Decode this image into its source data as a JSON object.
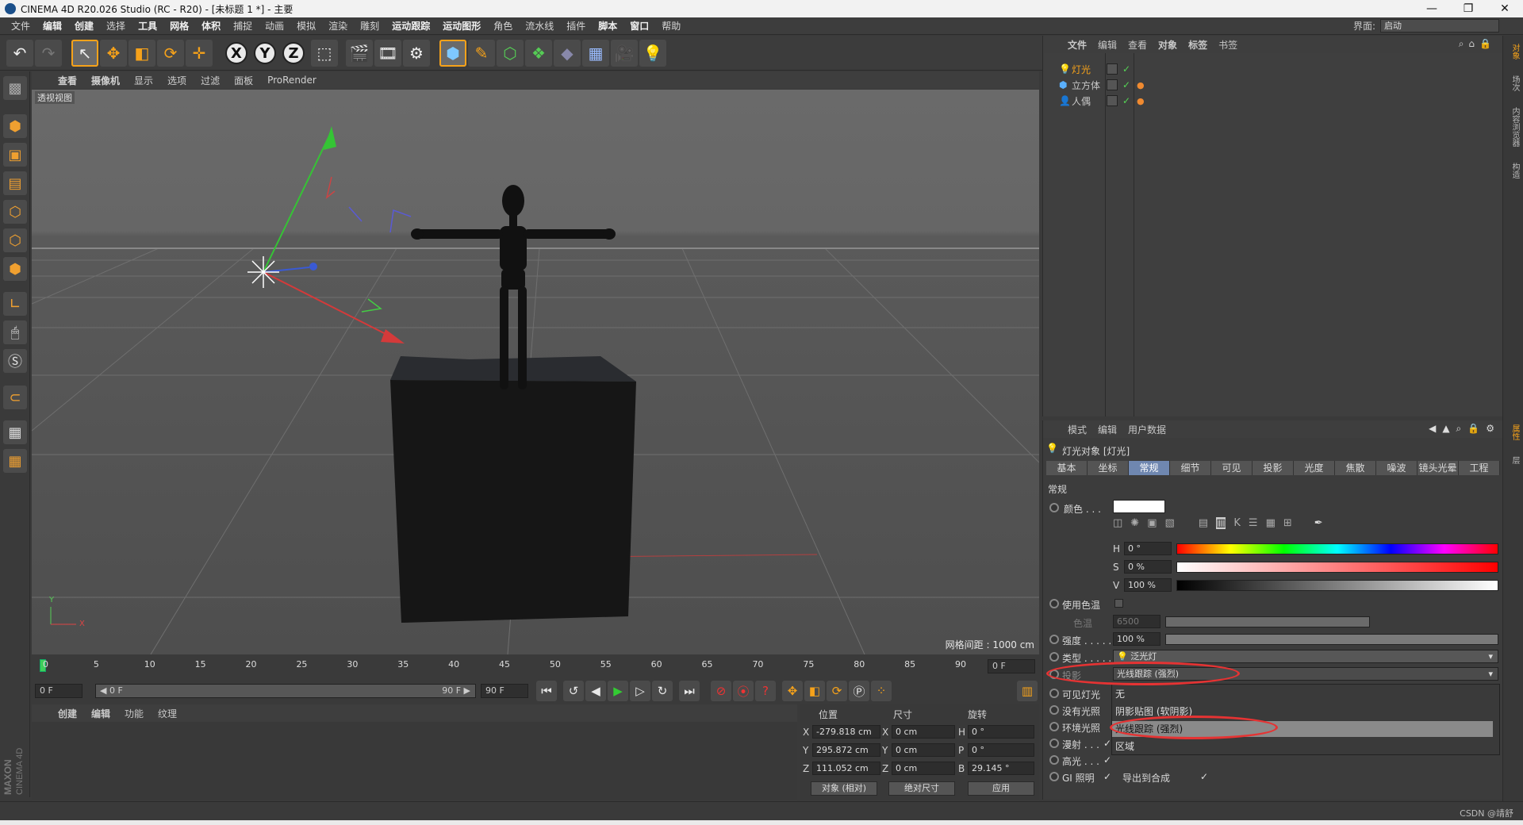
{
  "window": {
    "title": "CINEMA 4D R20.026 Studio (RC - R20) - [未标题 1 *] - 主要",
    "controls": [
      "—",
      "❐",
      "✕"
    ]
  },
  "menu": [
    "文件",
    "编辑",
    "创建",
    "选择",
    "工具",
    "网格",
    "体积",
    "捕捉",
    "动画",
    "模拟",
    "渲染",
    "雕刻",
    "运动跟踪",
    "运动图形",
    "角色",
    "流水线",
    "插件",
    "脚本",
    "窗口",
    "帮助"
  ],
  "layout": {
    "label": "界面:",
    "value": "启动"
  },
  "viewport": {
    "menu": [
      "查看",
      "摄像机",
      "显示",
      "选项",
      "过滤",
      "面板",
      "ProRender"
    ],
    "label": "透视视图",
    "grid_info": "网格间距 : 1000 cm",
    "axis_y": "Y",
    "axis_x": "X"
  },
  "timeline": {
    "ticks": [
      "0",
      "5",
      "10",
      "15",
      "20",
      "25",
      "30",
      "35",
      "40",
      "45",
      "50",
      "55",
      "60",
      "65",
      "70",
      "75",
      "80",
      "85",
      "90"
    ],
    "end_field": "0 F",
    "start": "0 F",
    "slider_left": "◀ 0 F",
    "slider_right": "90 F ▶",
    "max": "90 F"
  },
  "material": {
    "menu": [
      "创建",
      "编辑",
      "功能",
      "纹理"
    ]
  },
  "coords": {
    "headers": [
      "位置",
      "尺寸",
      "旋转"
    ],
    "rows": [
      {
        "axis": "X",
        "pos": "-279.818 cm",
        "size_axis": "X",
        "size": "0 cm",
        "rot_axis": "H",
        "rot": "0 °"
      },
      {
        "axis": "Y",
        "pos": "295.872 cm",
        "size_axis": "Y",
        "size": "0 cm",
        "rot_axis": "P",
        "rot": "0 °"
      },
      {
        "axis": "Z",
        "pos": "111.052 cm",
        "size_axis": "Z",
        "size": "0 cm",
        "rot_axis": "B",
        "rot": "29.145 °"
      }
    ],
    "mode": "对象 (相对)",
    "sizing": "绝对尺寸",
    "apply": "应用"
  },
  "objects": {
    "menu": [
      "文件",
      "编辑",
      "查看",
      "对象",
      "标签",
      "书签"
    ],
    "items": [
      {
        "name": "灯光",
        "icon": "light-icon"
      },
      {
        "name": "立方体",
        "icon": "cube-icon"
      },
      {
        "name": "人偶",
        "icon": "figure-icon"
      }
    ]
  },
  "attributes": {
    "menu": [
      "模式",
      "编辑",
      "用户数据"
    ],
    "title": "灯光对象 [灯光]",
    "tabs": [
      "基本",
      "坐标",
      "常规",
      "细节",
      "可见",
      "投影",
      "光度",
      "焦散",
      "噪波",
      "镜头光晕",
      "工程"
    ],
    "active_tab": "常规",
    "section": "常规",
    "color_label": "颜色 . . .",
    "color_value": "#ffffff",
    "h": {
      "label": "H",
      "value": "0 °"
    },
    "s": {
      "label": "S",
      "value": "0 %"
    },
    "v": {
      "label": "V",
      "value": "100 %"
    },
    "use_temp": "使用色温",
    "temp_label": "色温",
    "temp_value": "6500",
    "intensity_label": "强度 . . . . .",
    "intensity_value": "100 %",
    "intensity": 1.0,
    "type_label": "类型 . . . . .",
    "type_value": "泛光灯",
    "shadow_label": "投影",
    "shadow_value": "光线跟踪 (强烈)",
    "rows": [
      "可见灯光",
      "没有光照",
      "环境光照",
      "漫射 . . .",
      "高光 . . .",
      "GI 照明"
    ],
    "dropdown": [
      "无",
      "阴影贴图 (软阴影)",
      "光线跟踪 (强烈)",
      "区域"
    ],
    "export_label": "导出到合成"
  },
  "right_tabs": [
    "对象",
    "场次",
    "内容浏览器",
    "构造"
  ],
  "right_tabs2": [
    "属性",
    "层"
  ],
  "watermark": "CSDN @靖舒",
  "colors": {
    "accent": "#6f87b0",
    "highlight": "#f6a21a",
    "ring": "#e53333"
  }
}
